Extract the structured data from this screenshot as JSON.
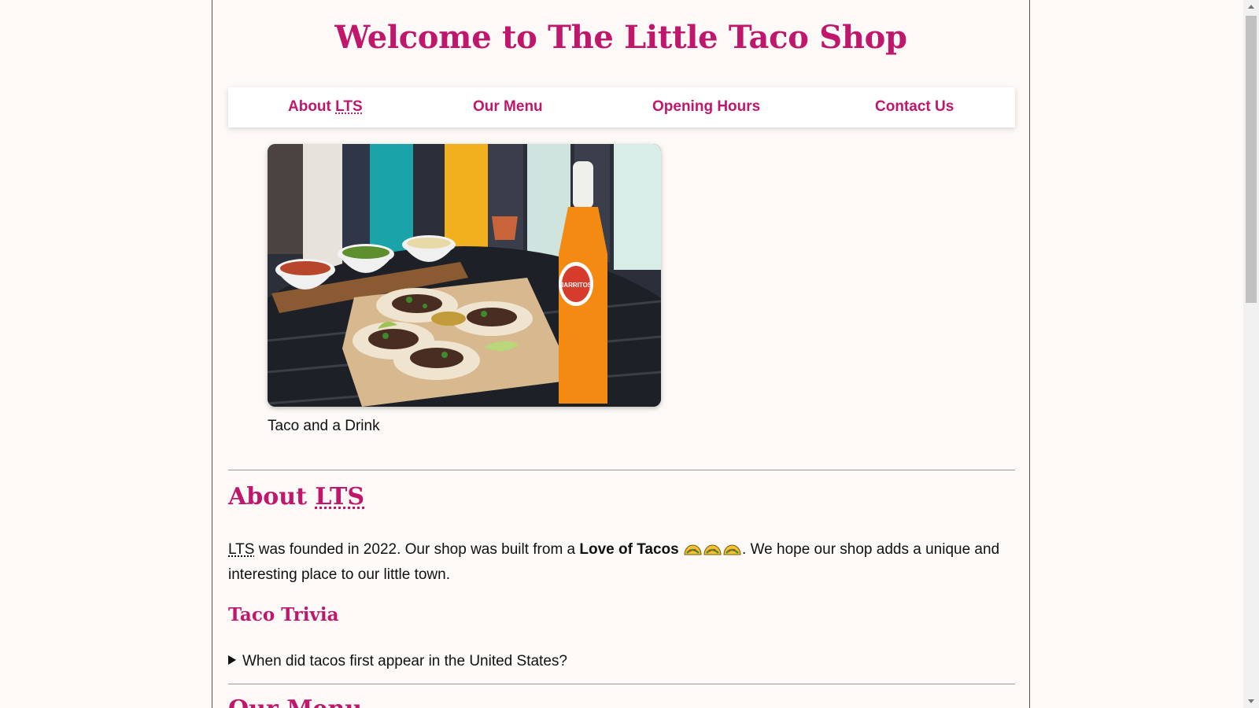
{
  "header": {
    "title": "Welcome to The Little Taco Shop"
  },
  "nav": {
    "about_prefix": "About",
    "about_abbr": "LTS",
    "menu": "Our Menu",
    "hours": "Opening Hours",
    "contact": "Contact Us"
  },
  "hero": {
    "caption": "Taco and a Drink",
    "bottle_label": "JARRITOS"
  },
  "about": {
    "heading_prefix": "About",
    "heading_abbr": "LTS",
    "abbr": "LTS",
    "text_part1": " was founded in 2022. Our shop was built from a ",
    "bold_text": "Love of Tacos",
    "text_part2": ". We hope our shop adds a unique and interesting place to our little town.",
    "emoji_count": 3
  },
  "trivia": {
    "heading": "Taco Trivia",
    "question": "When did tacos first appear in the United States?"
  },
  "next_section": {
    "heading": "Our Menu"
  },
  "colors": {
    "accent": "#c0166b",
    "background": "#fcf9f6"
  }
}
